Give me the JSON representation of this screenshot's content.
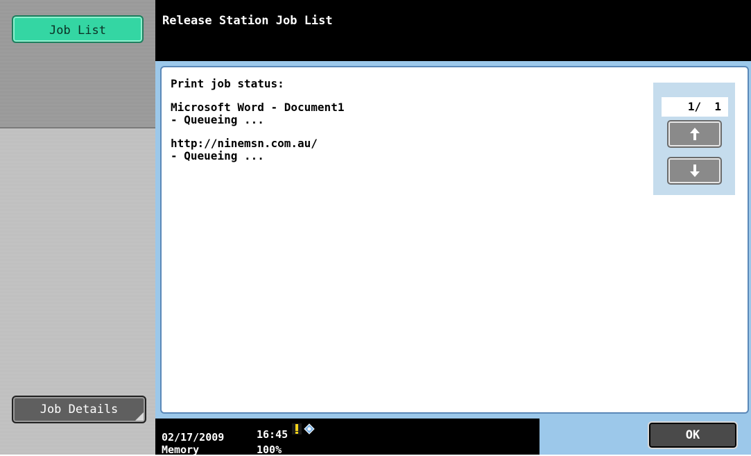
{
  "sidebar": {
    "job_list_label": "Job List",
    "job_details_label": "Job Details"
  },
  "header": {
    "title": "Release Station Job List"
  },
  "main": {
    "heading": "Print job status:",
    "jobs": [
      {
        "name": "Microsoft Word - Document1",
        "status": "- Queueing ..."
      },
      {
        "name": "http://ninemsn.com.au/",
        "status": "- Queueing ..."
      }
    ]
  },
  "pager": {
    "count": "1/  1",
    "up_icon": "arrow-up-icon",
    "down_icon": "arrow-down-icon"
  },
  "statusbar": {
    "date": "02/17/2009",
    "time": "16:45",
    "memory_label": "Memory",
    "memory_value": "100%",
    "icons": [
      "warning-icon",
      "network-icon"
    ]
  },
  "ok_label": "OK",
  "colors": {
    "accent_green": "#34d6a3",
    "panel_blue": "#9cc8ea",
    "header_black": "#000000"
  }
}
